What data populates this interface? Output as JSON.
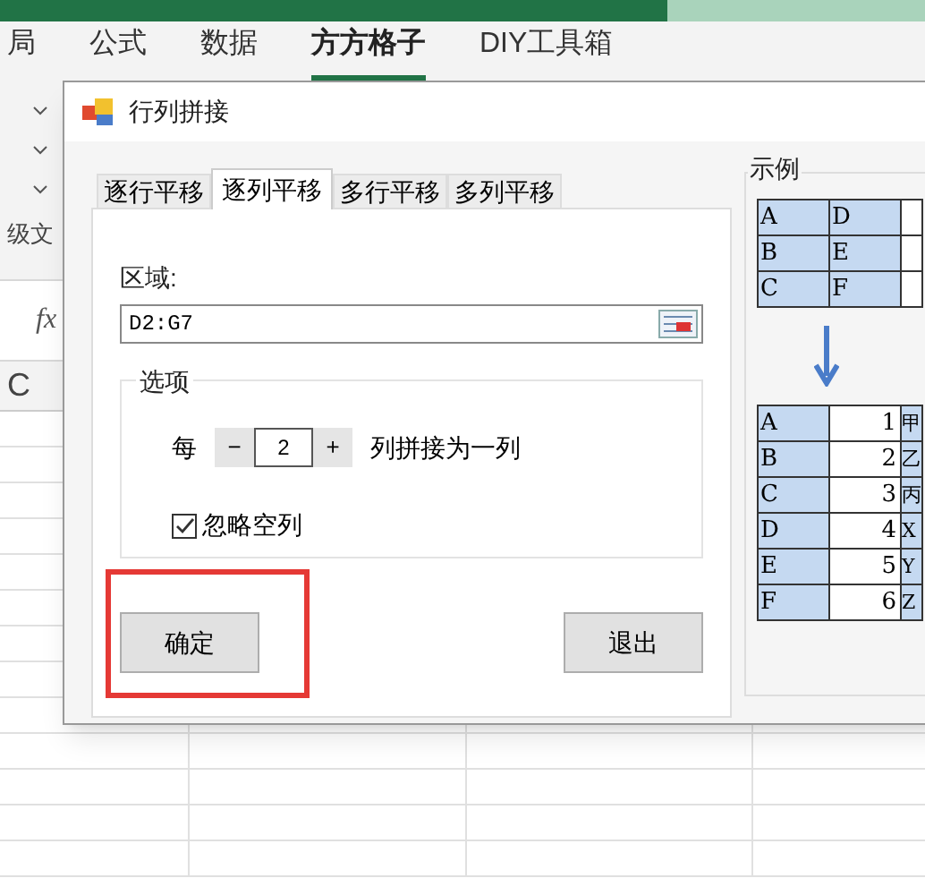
{
  "ribbon": {
    "tabs": [
      {
        "label": "局",
        "selected": false
      },
      {
        "label": "公式",
        "selected": false
      },
      {
        "label": "数据",
        "selected": false
      },
      {
        "label": "方方格子",
        "selected": true
      },
      {
        "label": "DIY工具箱",
        "selected": false
      }
    ],
    "group_label": "级文"
  },
  "formula_bar": {
    "fx": "fx"
  },
  "sheet": {
    "column_header": "C"
  },
  "dialog": {
    "title": "行列拼接",
    "tabs": [
      {
        "label": "逐行平移",
        "selected": false
      },
      {
        "label": "逐列平移",
        "selected": true
      },
      {
        "label": "多行平移",
        "selected": false
      },
      {
        "label": "多列平移",
        "selected": false
      }
    ],
    "range_label": "区域:",
    "range_value": "D2:G7",
    "options_title": "选项",
    "per_label": "每",
    "minus": "−",
    "count": "2",
    "plus": "+",
    "suffix": "列拼接为一列",
    "ignore_empty": {
      "label": "忽略空列",
      "checked": true
    },
    "buttons": [
      {
        "label": "确定",
        "highlighted": true
      },
      {
        "label": "退出",
        "highlighted": false
      }
    ],
    "example": {
      "title": "示例",
      "before": [
        [
          "A",
          "D"
        ],
        [
          "B",
          "E"
        ],
        [
          "C",
          "F"
        ]
      ],
      "after": [
        [
          "A",
          "1",
          "甲"
        ],
        [
          "B",
          "2",
          "乙"
        ],
        [
          "C",
          "3",
          "丙"
        ],
        [
          "D",
          "4",
          "X"
        ],
        [
          "E",
          "5",
          "Y"
        ],
        [
          "F",
          "6",
          "Z"
        ]
      ]
    }
  }
}
